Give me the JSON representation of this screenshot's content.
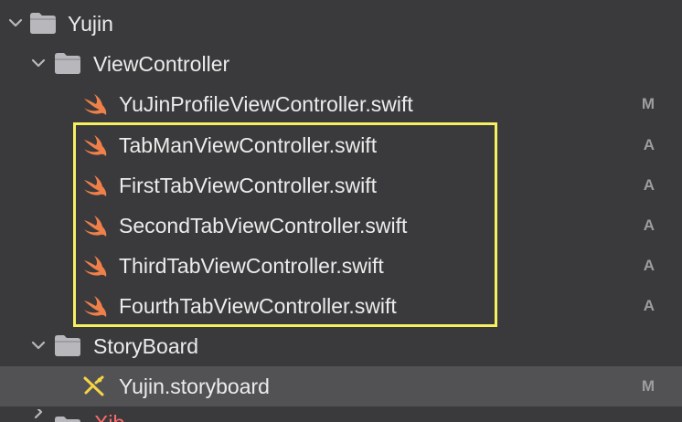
{
  "tree": {
    "root": {
      "label": "Yujin",
      "icon": "folder-icon",
      "expanded": true
    },
    "group_viewcontroller": {
      "label": "ViewController",
      "icon": "folder-icon",
      "expanded": true
    },
    "files_viewcontroller": [
      {
        "name": "YuJinProfileViewController.swift",
        "icon": "swift-icon",
        "status": "M"
      },
      {
        "name": "TabManViewController.swift",
        "icon": "swift-icon",
        "status": "A"
      },
      {
        "name": "FirstTabViewController.swift",
        "icon": "swift-icon",
        "status": "A"
      },
      {
        "name": "SecondTabViewController.swift",
        "icon": "swift-icon",
        "status": "A"
      },
      {
        "name": "ThirdTabViewController.swift",
        "icon": "swift-icon",
        "status": "A"
      },
      {
        "name": "FourthTabViewController.swift",
        "icon": "swift-icon",
        "status": "A"
      }
    ],
    "group_storyboard": {
      "label": "StoryBoard",
      "icon": "folder-icon",
      "expanded": true
    },
    "files_storyboard": [
      {
        "name": "Yujin.storyboard",
        "icon": "storyboard-icon",
        "status": "M",
        "selected": true
      }
    ],
    "partial_next": {
      "label": "Xib"
    }
  },
  "colors": {
    "background": "#3a3a3c",
    "selected_row": "#525254",
    "text": "#ececec",
    "status_text": "#9d9d9f",
    "swift_orange": "#f0804a",
    "storyboard_yellow": "#f5d547",
    "highlight_box": "#f6f061",
    "folder": "#b8b8bc",
    "partial_label": "#ff6a6a"
  }
}
